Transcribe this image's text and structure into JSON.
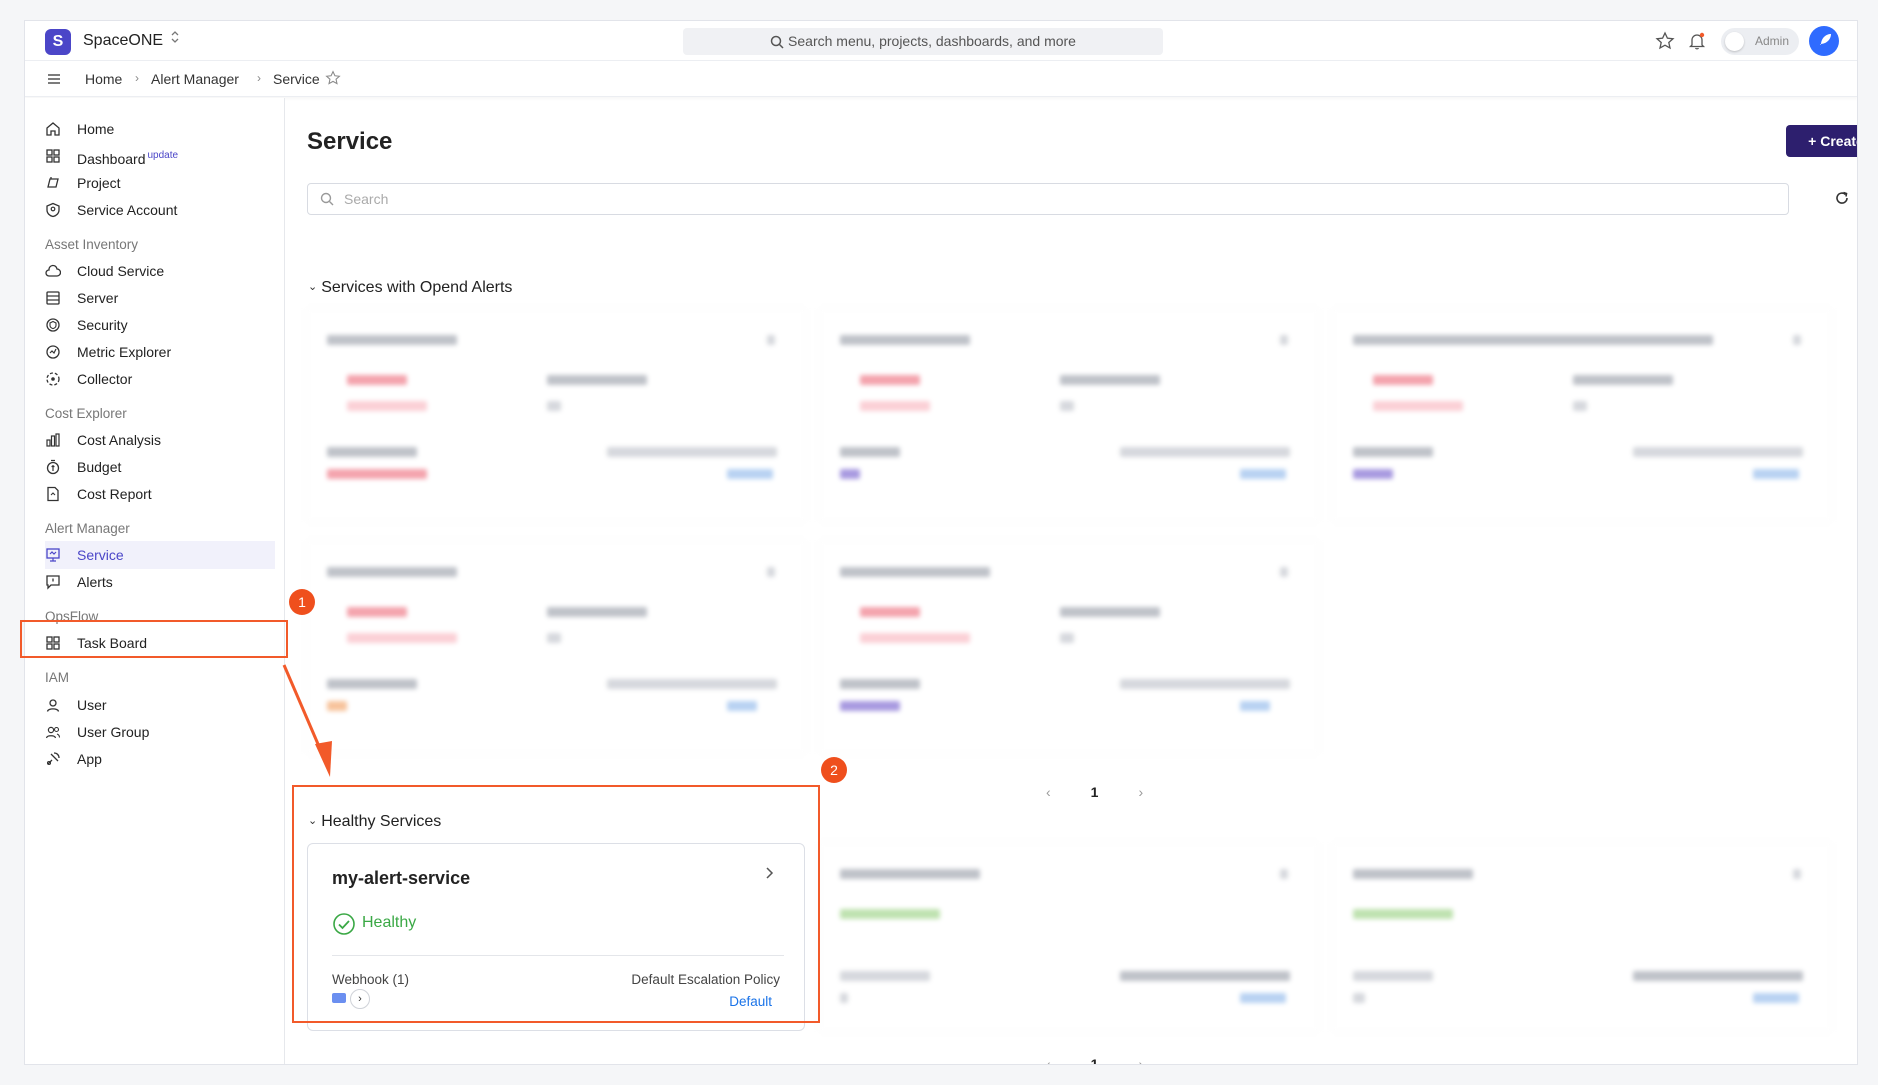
{
  "app": {
    "brand": "SpaceONE",
    "brand_caret": "⌃⌄",
    "logo_letter": "S"
  },
  "topbar": {
    "search_placeholder": "Search menu, projects, dashboards, and more",
    "admin_label": "Admin"
  },
  "breadcrumb": {
    "items": [
      "Home",
      "Alert Manager",
      "Service"
    ]
  },
  "sidebar": {
    "items": [
      {
        "label": "Home"
      },
      {
        "label": "Dashboard",
        "badge": "update"
      },
      {
        "label": "Project"
      },
      {
        "label": "Service Account"
      }
    ],
    "sections": [
      {
        "title": "Asset Inventory",
        "items": [
          "Cloud Service",
          "Server",
          "Security",
          "Metric Explorer",
          "Collector"
        ]
      },
      {
        "title": "Cost Explorer",
        "items": [
          "Cost Analysis",
          "Budget",
          "Cost Report"
        ]
      },
      {
        "title": "Alert Manager",
        "items": [
          "Service",
          "Alerts"
        ]
      },
      {
        "title": "OpsFlow",
        "items": [
          "Task Board"
        ]
      },
      {
        "title": "IAM",
        "items": [
          "User",
          "User Group",
          "App"
        ]
      }
    ]
  },
  "main": {
    "title": "Service",
    "create_label": "Create",
    "search_placeholder": "Search",
    "group_open": "Services with Opend Alerts",
    "group_healthy": "Healthy Services",
    "pager_open": "1",
    "pager_healthy": "1"
  },
  "healthy_card": {
    "name": "my-alert-service",
    "status": "Healthy",
    "webhook_label": "Webhook (1)",
    "policy_label": "Default Escalation Policy",
    "policy_value": "Default"
  },
  "annotations": {
    "one": "1",
    "two": "2"
  },
  "colors": {
    "accent": "#4b46c8",
    "create_bg": "#2d1f6e",
    "annotation": "#f25a2a",
    "healthy": "#3aa845",
    "link": "#1a73e8"
  }
}
